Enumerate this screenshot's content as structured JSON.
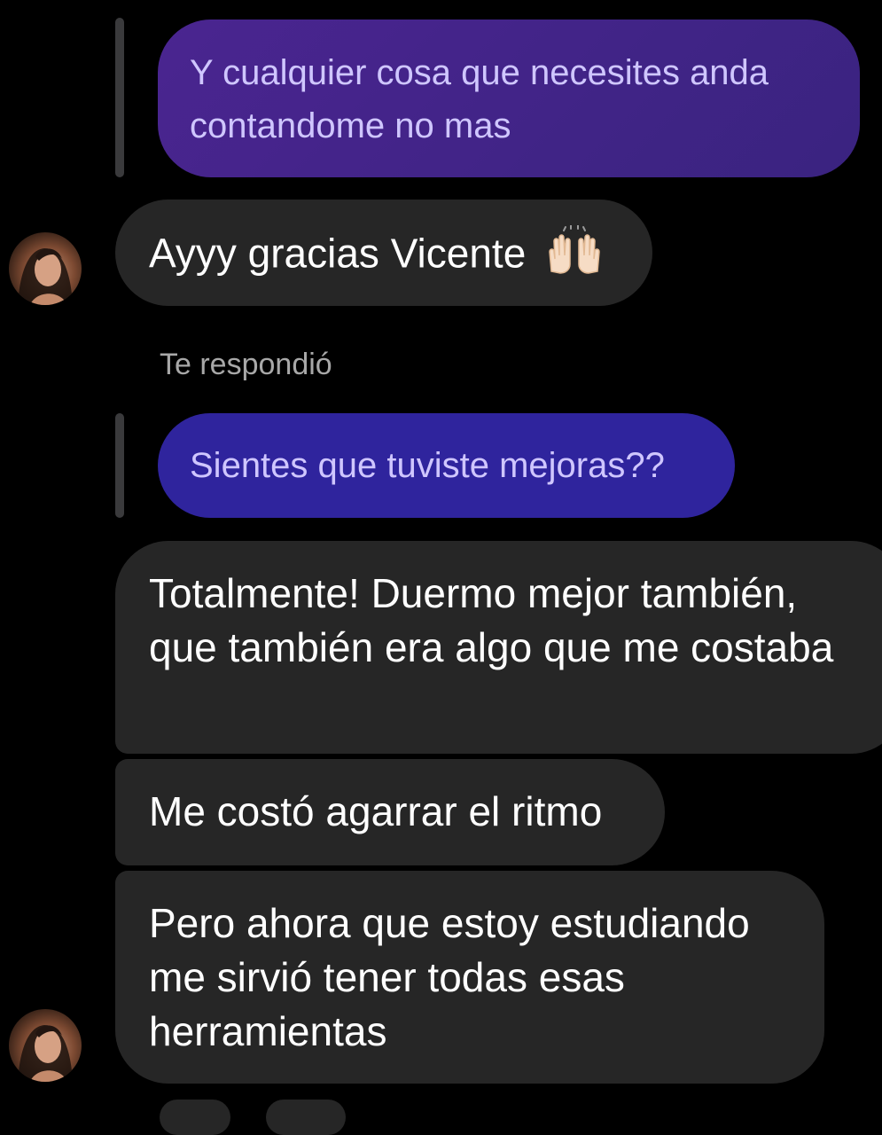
{
  "conversation": {
    "quoted_1": "Y cualquier cosa que necesites anda contandome no mas",
    "msg_1": "Ayyy gracias Vicente",
    "msg_1_emoji": "raised-hands-icon",
    "reply_label": "Te respondió",
    "quoted_2": "Sientes que tuviste mejoras??",
    "msg_2": "Totalmente! Duermo mejor también, que también era algo que me costaba",
    "msg_3": "Me costó agarrar el ritmo",
    "msg_4": "Pero ahora que estoy estudiando me sirvió tener todas esas herramientas"
  },
  "colors": {
    "background": "#000000",
    "quoted_bubble": "#3b2386",
    "incoming_bubble": "#262626",
    "reply_bar": "#3a3a3c",
    "label_gray": "#a8a8a8"
  }
}
